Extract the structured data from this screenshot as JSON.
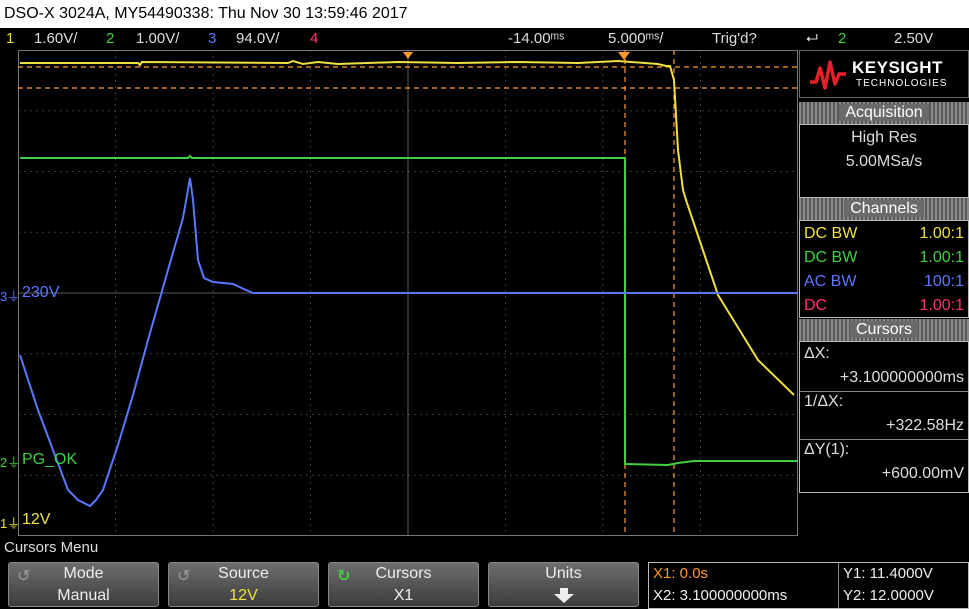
{
  "title": "DSO-X 3024A, MY54490338: Thu Nov 30 13:59:46 2017",
  "status": {
    "ch1_num": "1",
    "ch1_scale": "1.60V/",
    "ch2_num": "2",
    "ch2_scale": "1.00V/",
    "ch3_num": "3",
    "ch3_scale": "94.0V/",
    "ch4_num": "4",
    "delay": "-14.00ᵐˢ",
    "timebase": "5.000ᵐˢ/",
    "trigger_status": "Trig'd?",
    "trigger_icon": "⮠",
    "trigger_channel": "2",
    "trigger_level": "2.50V"
  },
  "markers": {
    "ch3_label": "230V",
    "ch2_label": "PG_OK",
    "ch1_label": "12V",
    "ch3_num": "3",
    "ch2_num": "2",
    "ch1_num": "1"
  },
  "brand": {
    "name": "KEYSIGHT",
    "sub": "TECHNOLOGIES"
  },
  "acquisition": {
    "header": "Acquisition",
    "mode": "High Res",
    "rate": "5.00MSa/s"
  },
  "channels": {
    "header": "Channels",
    "rows": [
      {
        "coupling": "DC BW",
        "probe": "1.00:1",
        "color": "#f0e040"
      },
      {
        "coupling": "DC BW",
        "probe": "1.00:1",
        "color": "#40d040"
      },
      {
        "coupling": "AC BW",
        "probe": "100:1",
        "color": "#5a78ff"
      },
      {
        "coupling": "DC",
        "probe": "1.00:1",
        "color": "#ff3070"
      }
    ]
  },
  "cursors": {
    "header": "Cursors",
    "dx_label": "ΔX:",
    "dx_value": "+3.100000000ms",
    "inv_dx_label": "1/ΔX:",
    "inv_dx_value": "+322.58Hz",
    "dy_label": "ΔY(1):",
    "dy_value": "+600.00mV"
  },
  "menu": {
    "title": "Cursors Menu",
    "mode_label": "Mode",
    "mode_value": "Manual",
    "source_label": "Source",
    "source_value": "12V",
    "cursors_label": "Cursors",
    "cursors_value": "X1",
    "units_label": "Units"
  },
  "readout": {
    "x1": "X1: 0.0s",
    "x2": "X2: 3.100000000ms",
    "y1": "Y1: 11.4000V",
    "y2": "Y2: 12.0000V"
  },
  "colors": {
    "ch1": "#f0e040",
    "ch2": "#40d040",
    "ch3": "#5a78ff",
    "ch4": "#ff3070",
    "cursor": "#ff9a30"
  }
}
